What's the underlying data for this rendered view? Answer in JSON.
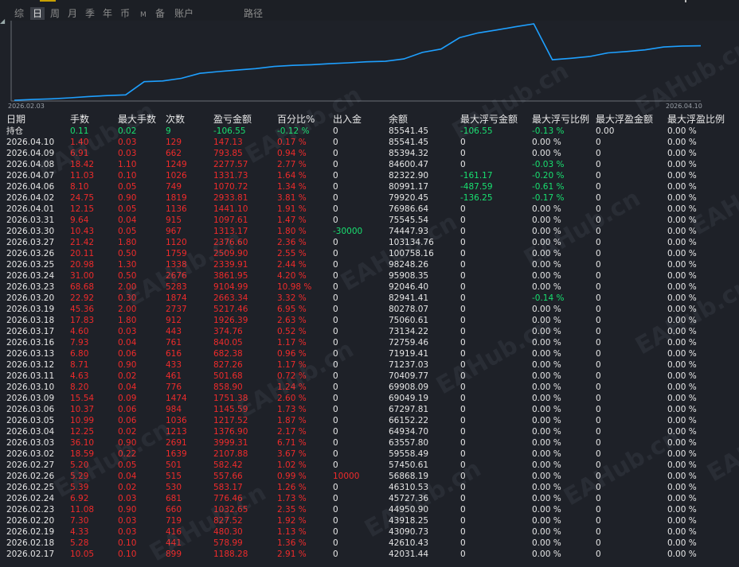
{
  "tabs": [
    {
      "label": "综",
      "active": false
    },
    {
      "label": "日",
      "active": true
    },
    {
      "label": "周",
      "active": false
    },
    {
      "label": "月",
      "active": false
    },
    {
      "label": "季",
      "active": false
    },
    {
      "label": "年",
      "active": false
    },
    {
      "label": "币",
      "active": false
    },
    {
      "label": "M",
      "active": false
    },
    {
      "label": "备",
      "active": false
    },
    {
      "label": "账户",
      "active": false
    },
    {
      "label": "路径",
      "active": false
    }
  ],
  "chart_data": {
    "type": "line",
    "x_start_label": "2026.02.03",
    "x_end_label": "2026.04.10",
    "line_color": "#1ea0ff",
    "axis_color": "#6a6e76",
    "grid": false
  },
  "watermark": "EAHub.cn",
  "table": {
    "headers": [
      "日期",
      "手数",
      "最大手数",
      "次数",
      "盈亏金额",
      "百分比%",
      "出入金",
      "余额",
      "最大浮亏金额",
      "最大浮亏比例",
      "最大浮盈金额",
      "最大浮盈比例"
    ],
    "rows": [
      [
        "持仓",
        "0.11",
        "0.02",
        "9",
        "-106.55",
        "-0.12 %",
        "0",
        "85541.45",
        "-106.55",
        "-0.13 %",
        "0.00",
        "0.00 %"
      ],
      [
        "2026.04.10",
        "1.40",
        "0.03",
        "129",
        "147.13",
        "0.17 %",
        "0",
        "85541.45",
        "0",
        "0.00 %",
        "0",
        "0.00 %"
      ],
      [
        "2026.04.09",
        "6.91",
        "0.03",
        "662",
        "793.85",
        "0.94 %",
        "0",
        "85394.32",
        "0",
        "0.00 %",
        "0",
        "0.00 %"
      ],
      [
        "2026.04.08",
        "18.42",
        "1.10",
        "1249",
        "2277.57",
        "2.77 %",
        "0",
        "84600.47",
        "0",
        "-0.03 %",
        "0",
        "0.00 %"
      ],
      [
        "2026.04.07",
        "11.03",
        "0.10",
        "1026",
        "1331.73",
        "1.64 %",
        "0",
        "82322.90",
        "-161.17",
        "-0.20 %",
        "0",
        "0.00 %"
      ],
      [
        "2026.04.06",
        "8.10",
        "0.05",
        "749",
        "1070.72",
        "1.34 %",
        "0",
        "80991.17",
        "-487.59",
        "-0.61 %",
        "0",
        "0.00 %"
      ],
      [
        "2026.04.02",
        "24.75",
        "0.90",
        "1819",
        "2933.81",
        "3.81 %",
        "0",
        "79920.45",
        "-136.25",
        "-0.17 %",
        "0",
        "0.00 %"
      ],
      [
        "2026.04.01",
        "12.15",
        "0.05",
        "1136",
        "1441.10",
        "1.91 %",
        "0",
        "76986.64",
        "0",
        "0.00 %",
        "0",
        "0.00 %"
      ],
      [
        "2026.03.31",
        "9.64",
        "0.04",
        "915",
        "1097.61",
        "1.47 %",
        "0",
        "75545.54",
        "0",
        "0.00 %",
        "0",
        "0.00 %"
      ],
      [
        "2026.03.30",
        "10.43",
        "0.05",
        "967",
        "1313.17",
        "1.80 %",
        "-30000",
        "74447.93",
        "0",
        "0.00 %",
        "0",
        "0.00 %"
      ],
      [
        "2026.03.27",
        "21.42",
        "1.80",
        "1120",
        "2376.60",
        "2.36 %",
        "0",
        "103134.76",
        "0",
        "0.00 %",
        "0",
        "0.00 %"
      ],
      [
        "2026.03.26",
        "20.11",
        "0.50",
        "1759",
        "2509.90",
        "2.55 %",
        "0",
        "100758.16",
        "0",
        "0.00 %",
        "0",
        "0.00 %"
      ],
      [
        "2026.03.25",
        "20.98",
        "1.30",
        "1338",
        "2339.91",
        "2.44 %",
        "0",
        "98248.26",
        "0",
        "0.00 %",
        "0",
        "0.00 %"
      ],
      [
        "2026.03.24",
        "31.00",
        "0.50",
        "2676",
        "3861.95",
        "4.20 %",
        "0",
        "95908.35",
        "0",
        "0.00 %",
        "0",
        "0.00 %"
      ],
      [
        "2026.03.23",
        "68.68",
        "2.00",
        "5283",
        "9104.99",
        "10.98 %",
        "0",
        "92046.40",
        "0",
        "0.00 %",
        "0",
        "0.00 %"
      ],
      [
        "2026.03.20",
        "22.92",
        "0.30",
        "1874",
        "2663.34",
        "3.32 %",
        "0",
        "82941.41",
        "0",
        "-0.14 %",
        "0",
        "0.00 %"
      ],
      [
        "2026.03.19",
        "45.36",
        "2.00",
        "2737",
        "5217.46",
        "6.95 %",
        "0",
        "80278.07",
        "0",
        "0.00 %",
        "0",
        "0.00 %"
      ],
      [
        "2026.03.18",
        "17.83",
        "1.80",
        "912",
        "1926.39",
        "2.63 %",
        "0",
        "75060.61",
        "0",
        "0.00 %",
        "0",
        "0.00 %"
      ],
      [
        "2026.03.17",
        "4.60",
        "0.03",
        "443",
        "374.76",
        "0.52 %",
        "0",
        "73134.22",
        "0",
        "0.00 %",
        "0",
        "0.00 %"
      ],
      [
        "2026.03.16",
        "7.93",
        "0.04",
        "761",
        "840.05",
        "1.17 %",
        "0",
        "72759.46",
        "0",
        "0.00 %",
        "0",
        "0.00 %"
      ],
      [
        "2026.03.13",
        "6.80",
        "0.06",
        "616",
        "682.38",
        "0.96 %",
        "0",
        "71919.41",
        "0",
        "0.00 %",
        "0",
        "0.00 %"
      ],
      [
        "2026.03.12",
        "8.71",
        "0.90",
        "433",
        "827.26",
        "1.17 %",
        "0",
        "71237.03",
        "0",
        "0.00 %",
        "0",
        "0.00 %"
      ],
      [
        "2026.03.11",
        "4.63",
        "0.02",
        "461",
        "501.68",
        "0.72 %",
        "0",
        "70409.77",
        "0",
        "0.00 %",
        "0",
        "0.00 %"
      ],
      [
        "2026.03.10",
        "8.20",
        "0.04",
        "776",
        "858.90",
        "1.24 %",
        "0",
        "69908.09",
        "0",
        "0.00 %",
        "0",
        "0.00 %"
      ],
      [
        "2026.03.09",
        "15.54",
        "0.09",
        "1474",
        "1751.38",
        "2.60 %",
        "0",
        "69049.19",
        "0",
        "0.00 %",
        "0",
        "0.00 %"
      ],
      [
        "2026.03.06",
        "10.37",
        "0.06",
        "984",
        "1145.59",
        "1.73 %",
        "0",
        "67297.81",
        "0",
        "0.00 %",
        "0",
        "0.00 %"
      ],
      [
        "2026.03.05",
        "10.99",
        "0.06",
        "1036",
        "1217.52",
        "1.87 %",
        "0",
        "66152.22",
        "0",
        "0.00 %",
        "0",
        "0.00 %"
      ],
      [
        "2026.03.04",
        "12.25",
        "0.02",
        "1213",
        "1376.90",
        "2.17 %",
        "0",
        "64934.70",
        "0",
        "0.00 %",
        "0",
        "0.00 %"
      ],
      [
        "2026.03.03",
        "36.10",
        "0.90",
        "2691",
        "3999.31",
        "6.71 %",
        "0",
        "63557.80",
        "0",
        "0.00 %",
        "0",
        "0.00 %"
      ],
      [
        "2026.03.02",
        "18.59",
        "0.22",
        "1639",
        "2107.88",
        "3.67 %",
        "0",
        "59558.49",
        "0",
        "0.00 %",
        "0",
        "0.00 %"
      ],
      [
        "2026.02.27",
        "5.20",
        "0.05",
        "501",
        "582.42",
        "1.02 %",
        "0",
        "57450.61",
        "0",
        "0.00 %",
        "0",
        "0.00 %"
      ],
      [
        "2026.02.26",
        "5.29",
        "0.04",
        "515",
        "557.66",
        "0.99 %",
        "10000",
        "56868.19",
        "0",
        "0.00 %",
        "0",
        "0.00 %"
      ],
      [
        "2026.02.25",
        "5.39",
        "0.02",
        "530",
        "583.17",
        "1.26 %",
        "0",
        "46310.53",
        "0",
        "0.00 %",
        "0",
        "0.00 %"
      ],
      [
        "2026.02.24",
        "6.92",
        "0.03",
        "681",
        "776.46",
        "1.73 %",
        "0",
        "45727.36",
        "0",
        "0.00 %",
        "0",
        "0.00 %"
      ],
      [
        "2026.02.23",
        "11.08",
        "0.90",
        "660",
        "1032.65",
        "2.35 %",
        "0",
        "44950.90",
        "0",
        "0.00 %",
        "0",
        "0.00 %"
      ],
      [
        "2026.02.20",
        "7.30",
        "0.03",
        "719",
        "827.52",
        "1.92 %",
        "0",
        "43918.25",
        "0",
        "0.00 %",
        "0",
        "0.00 %"
      ],
      [
        "2026.02.19",
        "4.33",
        "0.03",
        "416",
        "480.30",
        "1.13 %",
        "0",
        "43090.73",
        "0",
        "0.00 %",
        "0",
        "0.00 %"
      ],
      [
        "2026.02.18",
        "5.28",
        "0.10",
        "441",
        "578.99",
        "1.36 %",
        "0",
        "42610.43",
        "0",
        "0.00 %",
        "0",
        "0.00 %"
      ],
      [
        "2026.02.17",
        "10.05",
        "0.10",
        "899",
        "1188.28",
        "2.91 %",
        "0",
        "42031.44",
        "0",
        "0.00 %",
        "0",
        "0.00 %"
      ]
    ]
  },
  "colors": {
    "positive": "#ef2b2b",
    "negative": "#18e070",
    "neutral": "#e6e6e6"
  }
}
